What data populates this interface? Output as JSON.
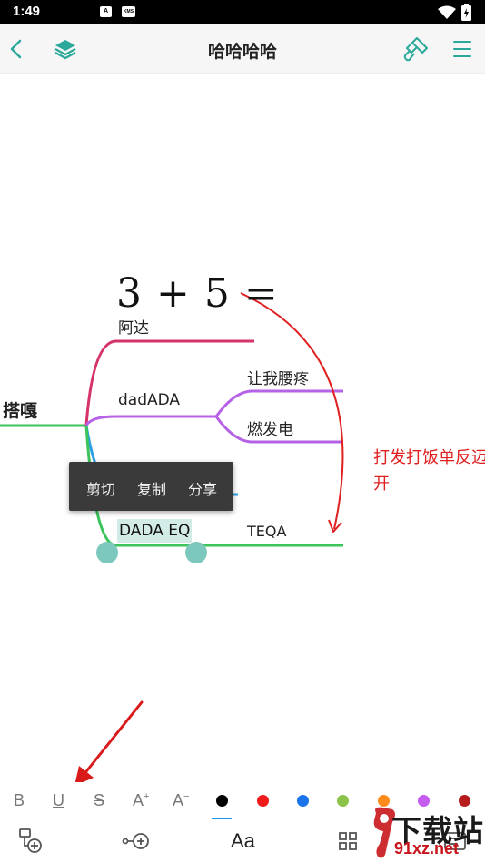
{
  "status_bar": {
    "time": "1:49",
    "notif_1": "A",
    "notif_2": "KMS"
  },
  "top_bar": {
    "title": "哈哈哈哈",
    "icons": [
      "back-arrow-icon",
      "layers-icon",
      "paint-brush-icon",
      "menu-icon"
    ]
  },
  "mindmap": {
    "formula": "3 + 5 =",
    "root": "搭嘎",
    "nodes": {
      "ada": "阿达",
      "dadada": "dadADA",
      "rangwo": "让我腰疼",
      "ranfa": "燃发电",
      "dada_eq": "DADA EQ",
      "teqa": "TEQA"
    },
    "annotation_line1": "打发打饭单反迈",
    "annotation_line2": "开",
    "colors": {
      "root_branch": "#3cc35a",
      "ada_branch": "#d6336c",
      "dadada_branch": "#b562e6",
      "hidden_branch": "#2b9fe0",
      "annotation": "#e02020"
    }
  },
  "context_menu": {
    "cut": "剪切",
    "copy": "复制",
    "share": "分享"
  },
  "format_bar": {
    "bold": "B",
    "underline": "U",
    "strike": "S",
    "font_up": "A",
    "font_up_sign": "+",
    "font_down": "A",
    "font_down_sign": "−",
    "colors": [
      "#000000",
      "#ef1a1a",
      "#1a73e8",
      "#8bc34a",
      "#ff8c1a",
      "#c45cf0",
      "#b71c1c"
    ]
  },
  "bottom_toolbar": {
    "text_label": "Aa",
    "icons": [
      "add-child-node-icon",
      "add-sibling-node-icon",
      "text-style-icon",
      "layout-icon",
      "style-icon"
    ]
  },
  "watermark": {
    "line1": "下载站",
    "line2": "91xz.net"
  }
}
